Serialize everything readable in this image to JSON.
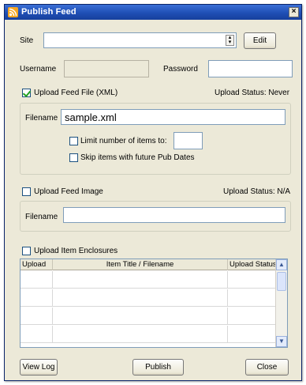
{
  "window": {
    "title": "Publish Feed"
  },
  "site": {
    "label": "Site",
    "value": "",
    "edit_label": "Edit"
  },
  "credentials": {
    "username_label": "Username",
    "username_value": "",
    "password_label": "Password",
    "password_value": ""
  },
  "feed_file": {
    "checkbox_label": "Upload Feed File (XML)",
    "checked": true,
    "status": "Upload Status: Never",
    "filename_label": "Filename",
    "filename_value": "sample.xml",
    "limit_label": "Limit number of items to:",
    "limit_value": "",
    "skip_label": "Skip items with future Pub Dates"
  },
  "feed_image": {
    "checkbox_label": "Upload Feed Image",
    "checked": false,
    "status": "Upload Status: N/A",
    "filename_label": "Filename",
    "filename_value": ""
  },
  "enclosures": {
    "checkbox_label": "Upload Item Enclosures",
    "checked": false,
    "columns": [
      "Upload",
      "Item Title / Filename",
      "Upload Status"
    ],
    "rows": [
      [
        "",
        "",
        ""
      ],
      [
        "",
        "",
        ""
      ],
      [
        "",
        "",
        ""
      ],
      [
        "",
        "",
        ""
      ]
    ]
  },
  "buttons": {
    "view_log": "View Log",
    "publish": "Publish",
    "close": "Close"
  },
  "icons": {
    "app": "feed-app-icon",
    "close": "close-icon",
    "spin": "spinner-icon",
    "scroll_up": "scroll-up-icon",
    "scroll_down": "scroll-down-icon"
  }
}
